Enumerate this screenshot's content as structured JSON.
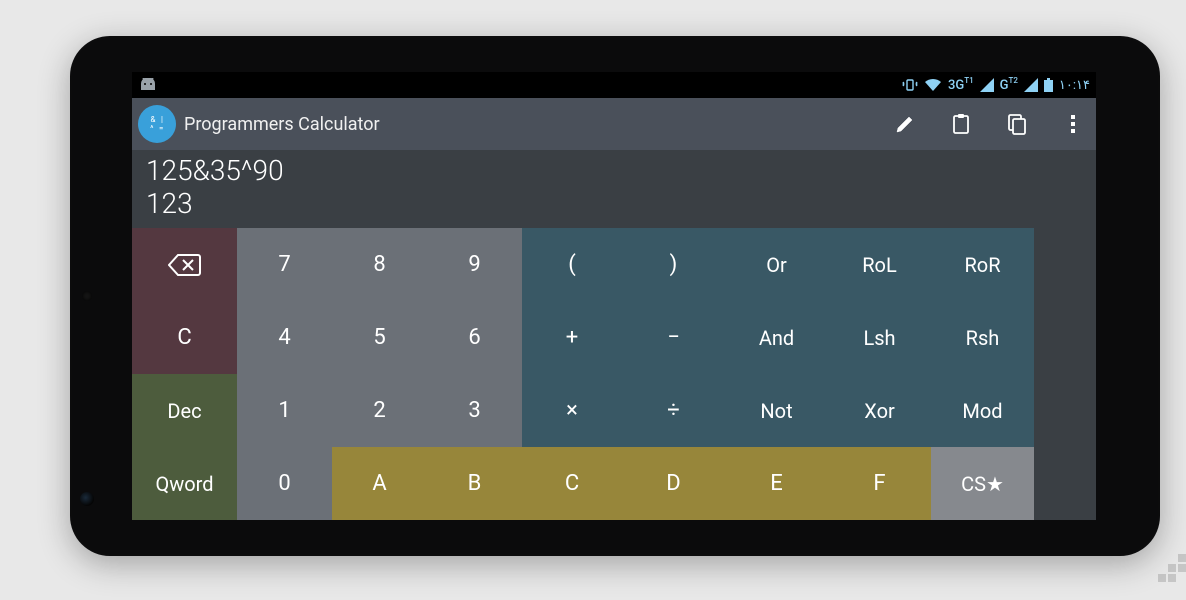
{
  "statusbar": {
    "net1": "3G",
    "net1_sup": "T1",
    "net2": "G",
    "net2_sup": "T2",
    "clock": "١٠:١۴"
  },
  "actionbar": {
    "title": "Programmers Calculator"
  },
  "display": {
    "expression": "125&35^90",
    "result": "123"
  },
  "keys": {
    "backspace": "⌫",
    "seven": "7",
    "eight": "8",
    "nine": "9",
    "lparen": "(",
    "rparen": ")",
    "or": "Or",
    "rol": "RoL",
    "ror": "RoR",
    "clear": "C",
    "four": "4",
    "five": "5",
    "six": "6",
    "plus": "+",
    "minus": "−",
    "and": "And",
    "lsh": "Lsh",
    "rsh": "Rsh",
    "dec": "Dec",
    "one": "1",
    "two": "2",
    "three": "3",
    "times": "×",
    "divide": "÷",
    "not": "Not",
    "xor": "Xor",
    "mod": "Mod",
    "qword": "Qword",
    "zero": "0",
    "a": "A",
    "b": "B",
    "c_hex": "C",
    "d": "D",
    "e": "E",
    "f": "F",
    "cs": "CS★"
  }
}
